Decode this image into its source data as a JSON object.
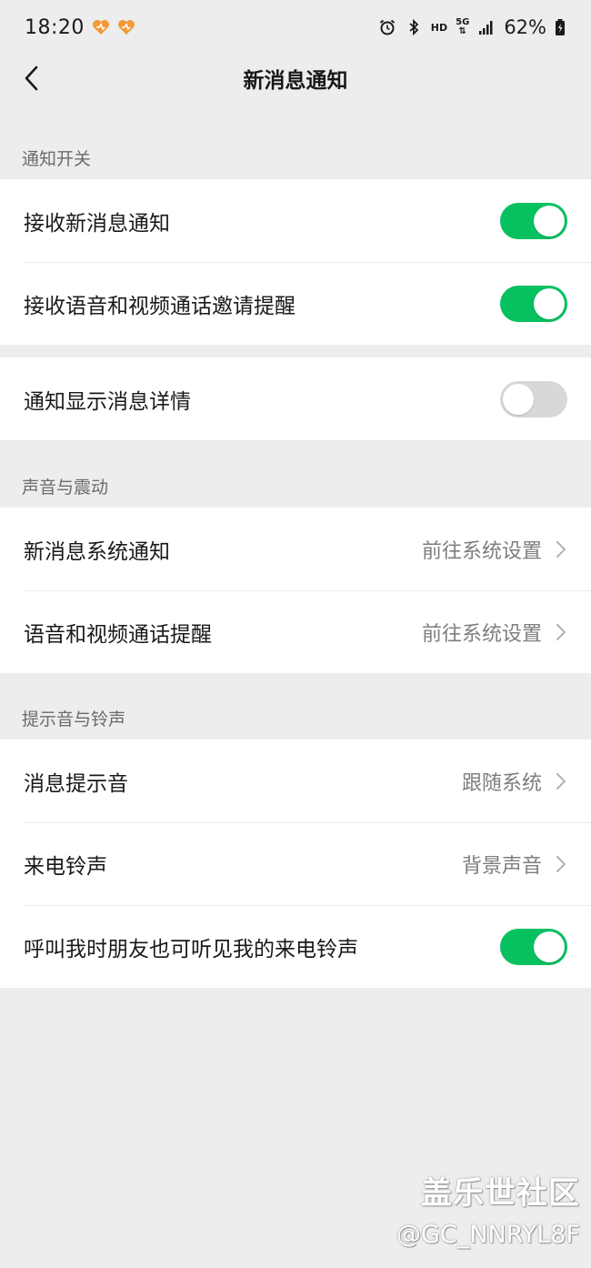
{
  "status_bar": {
    "time": "18:20",
    "hd": "HD",
    "network": "5G",
    "battery": "62%"
  },
  "nav": {
    "title": "新消息通知"
  },
  "sections": {
    "notify_switch": "通知开关",
    "sound_vibrate": "声音与震动",
    "tone_ringtone": "提示音与铃声"
  },
  "rows": {
    "receive_new": {
      "label": "接收新消息通知",
      "toggle": "on"
    },
    "receive_call": {
      "label": "接收语音和视频通话邀请提醒",
      "toggle": "on"
    },
    "show_detail": {
      "label": "通知显示消息详情",
      "toggle": "off"
    },
    "sys_notify": {
      "label": "新消息系统通知",
      "value": "前往系统设置"
    },
    "call_remind": {
      "label": "语音和视频通话提醒",
      "value": "前往系统设置"
    },
    "msg_tone": {
      "label": "消息提示音",
      "value": "跟随系统"
    },
    "ringtone": {
      "label": "来电铃声",
      "value": "背景声音"
    },
    "friend_hear": {
      "label": "呼叫我时朋友也可听见我的来电铃声",
      "toggle": "on"
    }
  },
  "watermark": {
    "line1": "盖乐世社区",
    "line2": "@GC_NNRYL8F"
  },
  "colors": {
    "accent_green": "#07c160",
    "background": "#ededed",
    "toggle_off": "#d8d8d8"
  }
}
